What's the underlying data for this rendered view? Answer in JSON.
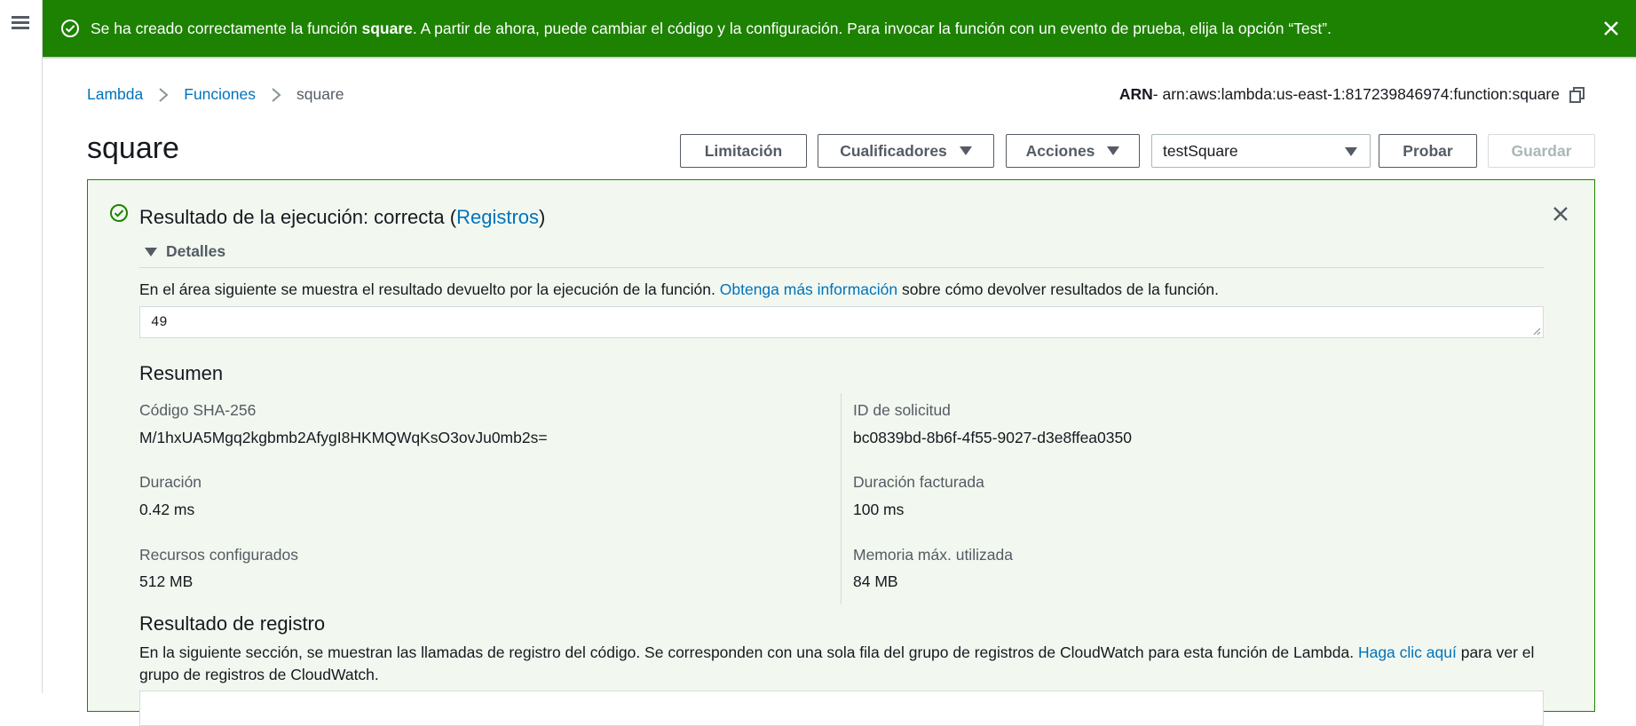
{
  "nav": {
    "menu_icon": "hamburger-menu-icon"
  },
  "flash": {
    "icon": "check-circle-icon",
    "text_before": "Se ha creado correctamente la función ",
    "function_name": "square",
    "text_after": ". A partir de ahora, puede cambiar el código y la configuración. Para invocar la función con un evento de prueba, elija la opción “Test”.",
    "close_icon": "close-icon",
    "color": "#1d8102"
  },
  "breadcrumb": {
    "items": [
      "Lambda",
      "Funciones"
    ],
    "current": "square"
  },
  "arn": {
    "label": "ARN",
    "value": " - arn:aws:lambda:us-east-1:817239846974:function:square",
    "copy_icon": "copy-icon"
  },
  "page_title": "square",
  "toolbar": {
    "throttle_label": "Limitación",
    "qualifiers_label": "Cualificadores",
    "actions_label": "Acciones",
    "test_event_selected": "testSquare",
    "test_label": "Probar",
    "save_label": "Guardar"
  },
  "result": {
    "heading_prefix": "Resultado de la ejecución: correcta (",
    "heading_link": "Registros",
    "heading_suffix": ")",
    "details_label": "Detalles",
    "description_prefix": "En el área siguiente se muestra el resultado devuelto por la ejecución de la función. ",
    "description_link": "Obtenga más información",
    "description_suffix": " sobre cómo devolver resultados de la función.",
    "output": "49",
    "accent_color": "#1d8102",
    "link_color": "#0073bb"
  },
  "summary": {
    "title": "Resumen",
    "code_sha_label": "Código SHA-256",
    "code_sha_value": "M/1hxUA5Mgq2kgbmb2AfygI8HKMQWqKsO3ovJu0mb2s=",
    "request_id_label": "ID de solicitud",
    "request_id_value": "bc0839bd-8b6f-4f55-9027-d3e8ffea0350",
    "duration_label": "Duración",
    "duration_value": "0.42 ms",
    "billed_duration_label": "Duración facturada",
    "billed_duration_value": "100 ms",
    "resources_label": "Recursos configurados",
    "resources_value": "512 MB",
    "max_memory_label": "Memoria máx. utilizada",
    "max_memory_value": "84 MB"
  },
  "log": {
    "title": "Resultado de registro",
    "description_prefix": "En la siguiente sección, se muestran las llamadas de registro del código. Se corresponden con una sola fila del grupo de registros de CloudWatch para esta función de Lambda. ",
    "description_link": "Haga clic aquí",
    "description_suffix": " para ver el grupo de registros de CloudWatch."
  }
}
